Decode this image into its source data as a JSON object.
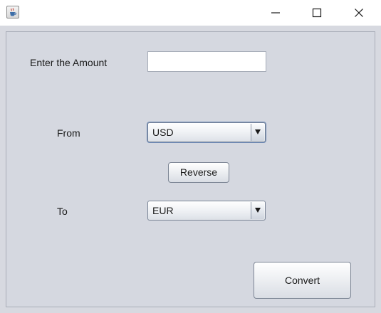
{
  "window": {
    "icon": "java-cup-icon",
    "controls": [
      "minimize-icon",
      "maximize-icon",
      "close-icon"
    ]
  },
  "form": {
    "amount_label": "Enter the Amount",
    "amount_value": "",
    "from_label": "From",
    "from_selected": "USD",
    "reverse_label": "Reverse",
    "to_label": "To",
    "to_selected": "EUR",
    "convert_label": "Convert"
  }
}
